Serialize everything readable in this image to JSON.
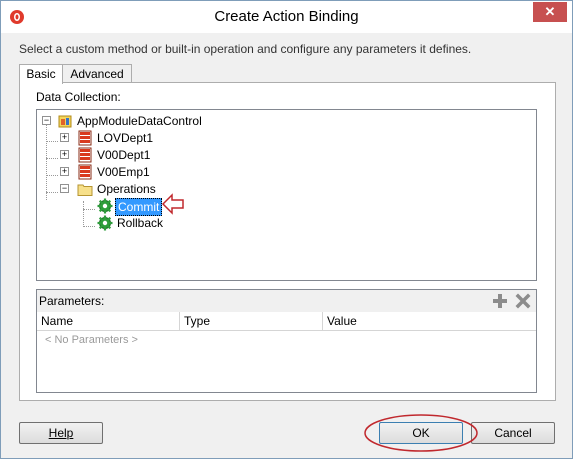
{
  "window": {
    "title": "Create Action Binding",
    "close_glyph": "✕"
  },
  "description": "Select a custom method or built-in operation and configure any parameters it defines.",
  "tabs": [
    {
      "label": "Basic"
    },
    {
      "label": "Advanced"
    }
  ],
  "data_collection": {
    "label": "Data Collection:",
    "tree": {
      "root": "AppModuleDataControl",
      "items": [
        "LOVDept1",
        "V00Dept1",
        "V00Emp1"
      ],
      "operations": {
        "label": "Operations",
        "children": [
          "Commit",
          "Rollback"
        ]
      },
      "selected": "Commit"
    }
  },
  "parameters": {
    "label": "Parameters:",
    "columns": [
      "Name",
      "Type",
      "Value"
    ],
    "empty_text": "< No Parameters >"
  },
  "buttons": {
    "help": "Help",
    "ok": "OK",
    "cancel": "Cancel"
  },
  "colors": {
    "selection": "#3399ff",
    "annotation": "#c0282d",
    "gear": "#2e9e3b"
  }
}
